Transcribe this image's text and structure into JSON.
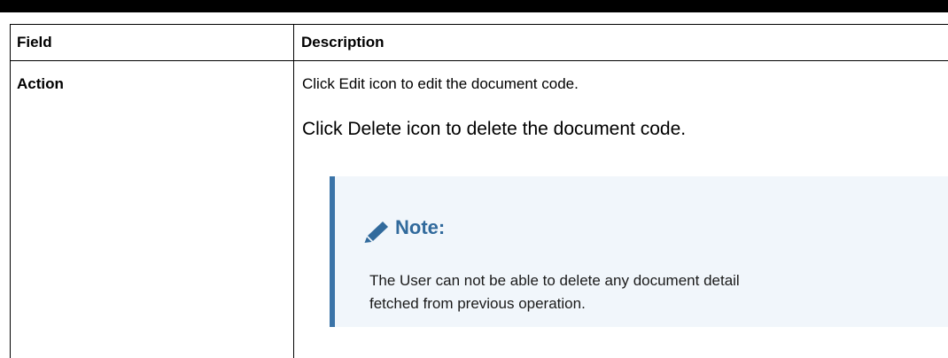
{
  "table": {
    "headers": {
      "field": "Field",
      "description": "Description"
    },
    "rows": [
      {
        "field": "Action",
        "description": {
          "line1": "Click Edit icon to edit the document code.",
          "line2": "Click Delete icon to delete the document code.",
          "note": {
            "icon": "pencil-icon",
            "title": "Note:",
            "body_line1": "The User can not be able to delete any document detail",
            "body_line2": "fetched from previous operation."
          }
        }
      }
    ]
  },
  "colors": {
    "note_accent": "#3b74a8",
    "note_title": "#316a9c",
    "note_background": "#f1f6fb"
  }
}
